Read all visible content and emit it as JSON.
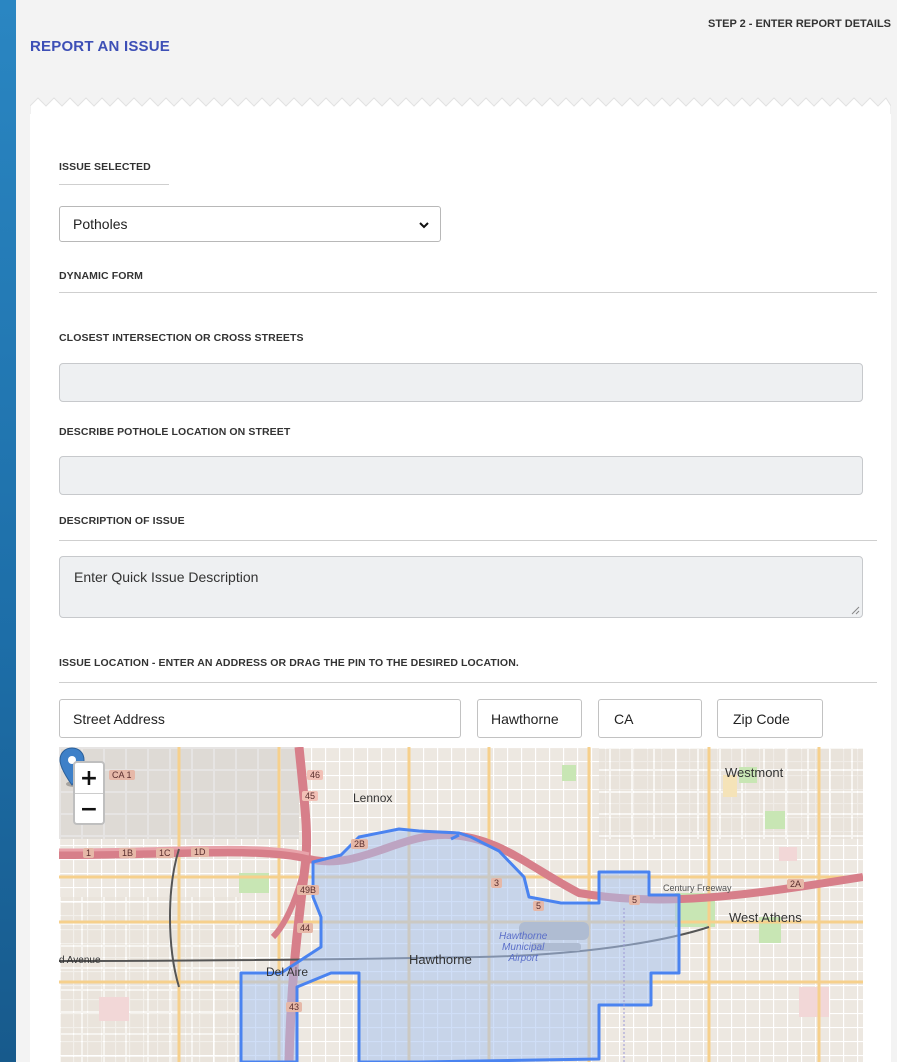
{
  "header": {
    "title": "REPORT AN ISSUE",
    "step": "STEP 2 - ENTER REPORT DETAILS"
  },
  "form": {
    "issue_selected_label": "ISSUE SELECTED",
    "issue_selected_value": "Potholes",
    "dynamic_form_label": "DYNAMIC FORM",
    "cross_streets_label": "CLOSEST INTERSECTION OR CROSS STREETS",
    "pothole_location_label": "DESCRIBE POTHOLE LOCATION ON STREET",
    "description_label": "DESCRIPTION OF ISSUE",
    "description_placeholder": "Enter Quick Issue Description",
    "location_label": "ISSUE LOCATION - ENTER AN ADDRESS OR DRAG THE PIN TO THE DESIRED LOCATION.",
    "street_placeholder": "Street Address",
    "city_value": "Hawthorne",
    "state_value": "CA",
    "zip_placeholder": "Zip Code"
  },
  "map": {
    "zoom_in": "+",
    "zoom_out": "−",
    "places": {
      "westmont": "Westmont",
      "lennox": "Lennox",
      "west_athens": "West Athens",
      "del_aire": "Del Aire",
      "hawthorne": "Hawthorne",
      "avenue": "d Avenue",
      "airport_1": "Hawthorne",
      "airport_2": "Municipal",
      "airport_3": "Airport",
      "century_freeway": "Century Freeway"
    },
    "shields": {
      "ca1": "CA 1",
      "r46": "46",
      "r45": "45",
      "r1": "1",
      "r1b": "1B",
      "r1c": "1C",
      "r1d": "1D",
      "r2b": "2B",
      "r3": "3",
      "r5a": "5",
      "r5b": "5",
      "r49b": "49B",
      "r44": "44",
      "r43": "43",
      "r2a": "2A"
    },
    "colors": {
      "boundary": "#4a83f0",
      "fill": "#a8c2f0",
      "freeway": "#d77f8a",
      "pin": "#3e80c8"
    }
  },
  "icons": {
    "select_chevron": "chevron-down-icon",
    "map_pin": "map-pin-icon"
  }
}
